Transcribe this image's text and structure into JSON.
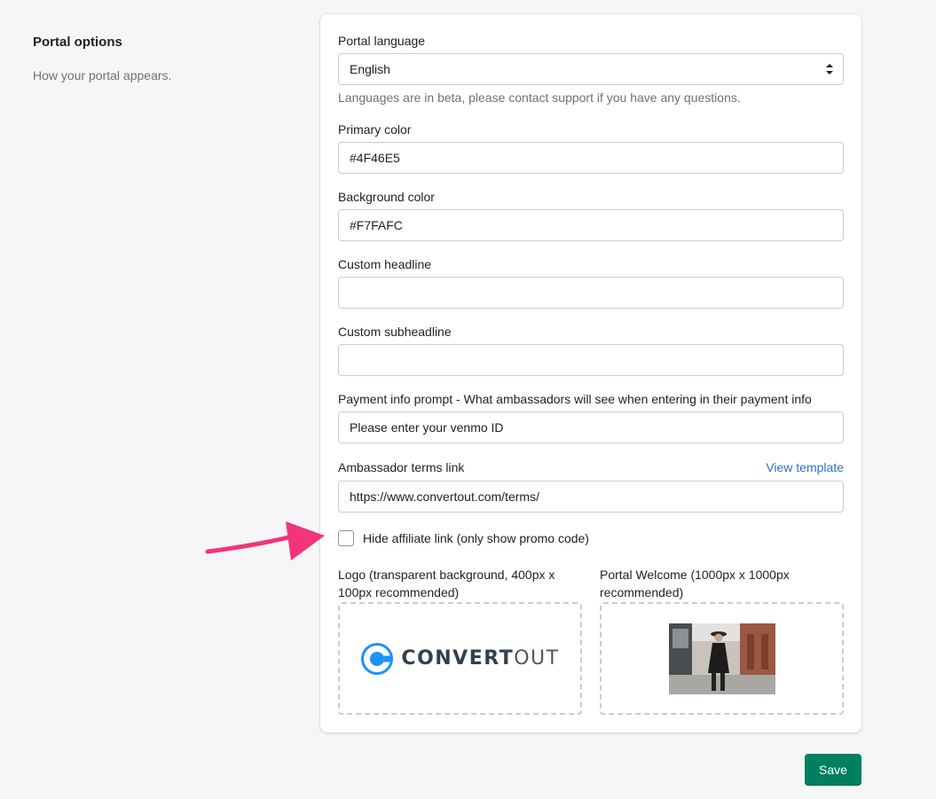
{
  "section": {
    "title": "Portal options",
    "description": "How your portal appears."
  },
  "form": {
    "portal_language": {
      "label": "Portal language",
      "value": "English",
      "help": "Languages are in beta, please contact support if you have any questions."
    },
    "primary_color": {
      "label": "Primary color",
      "value": "#4F46E5"
    },
    "background_color": {
      "label": "Background color",
      "value": "#F7FAFC"
    },
    "custom_headline": {
      "label": "Custom headline",
      "value": ""
    },
    "custom_subheadline": {
      "label": "Custom subheadline",
      "value": ""
    },
    "payment_info_prompt": {
      "label": "Payment info prompt - What ambassadors will see when entering in their payment info",
      "value": "Please enter your venmo ID"
    },
    "ambassador_terms_link": {
      "label": "Ambassador terms link",
      "link_text": "View template",
      "value": "https://www.convertout.com/terms/"
    },
    "hide_affiliate_link": {
      "label": "Hide affiliate link (only show promo code)",
      "checked": false
    },
    "logo_upload": {
      "label": "Logo (transparent background, 400px x 100px recommended)",
      "logo_text_bold": "CONVERT",
      "logo_text_light": "OUT"
    },
    "portal_welcome_upload": {
      "label": "Portal Welcome (1000px x 1000px recommended)"
    }
  },
  "actions": {
    "save_label": "Save"
  },
  "colors": {
    "accent": "#008060",
    "link": "#2c6ecb",
    "annotation_arrow": "#f2357a",
    "logo_blue": "#1e90ff"
  },
  "icons": {
    "select_arrows": "select-arrows-icon",
    "logo": "convertout-logo-icon",
    "annotation": "annotation-arrow-icon"
  }
}
